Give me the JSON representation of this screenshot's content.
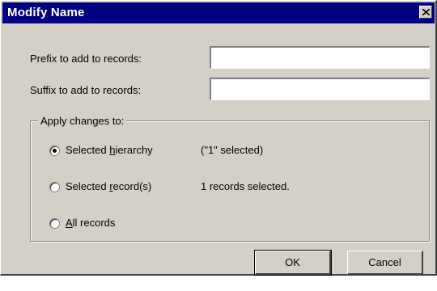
{
  "dialog": {
    "title": "Modify Name"
  },
  "prefix": {
    "label": "Prefix to add to records:",
    "value": ""
  },
  "suffix": {
    "label": "Suffix to add to records:",
    "value": ""
  },
  "apply": {
    "title": "Apply changes to:",
    "options": [
      {
        "label_pre": "Selected ",
        "label_accel": "h",
        "label_post": "ierarchy",
        "info": "(\"1\" selected)",
        "checked": true
      },
      {
        "label_pre": "Selected ",
        "label_accel": "r",
        "label_post": "ecord(s)",
        "info": "1 records selected.",
        "checked": false
      },
      {
        "label_pre": "",
        "label_accel": "A",
        "label_post": "ll records",
        "info": "",
        "checked": false
      }
    ]
  },
  "buttons": {
    "ok": "OK",
    "cancel": "Cancel"
  },
  "icons": {
    "close": "close-icon"
  },
  "colors": {
    "titlebar": "#000080",
    "face": "#d4d0c8"
  }
}
